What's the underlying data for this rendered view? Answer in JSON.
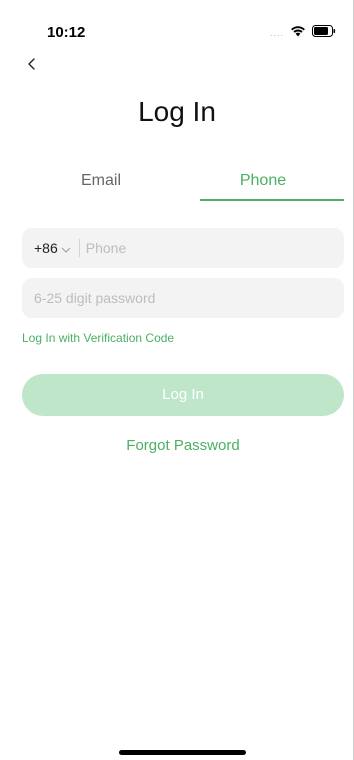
{
  "status_bar": {
    "time": "10:12",
    "signal_dots": "....",
    "icons": [
      "wifi-icon",
      "battery-icon"
    ]
  },
  "nav": {
    "back_icon": "back-chevron-icon"
  },
  "page": {
    "title": "Log In"
  },
  "tabs": [
    {
      "label": "Email",
      "active": false
    },
    {
      "label": "Phone",
      "active": true
    }
  ],
  "form": {
    "country_code": "+86",
    "phone_placeholder": "Phone",
    "phone_value": "",
    "password_placeholder": "6-25 digit password",
    "password_value": "",
    "verification_link": "Log In with Verification Code",
    "login_button": "Log In",
    "forgot_password": "Forgot Password"
  },
  "colors": {
    "accent": "#4caf63",
    "button_disabled_bg": "#bfe6c9",
    "field_bg": "#f3f3f3"
  }
}
